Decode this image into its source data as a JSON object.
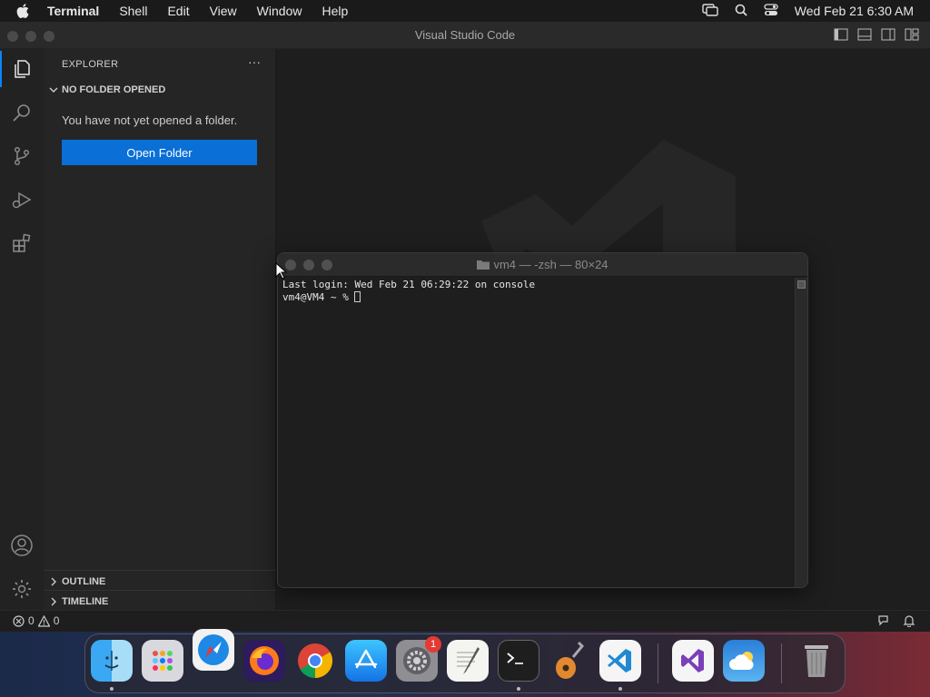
{
  "menubar": {
    "app_name": "Terminal",
    "items": [
      "Shell",
      "Edit",
      "View",
      "Window",
      "Help"
    ],
    "datetime": "Wed Feb 21  6:30 AM"
  },
  "vscode": {
    "window_title": "Visual Studio Code",
    "sidebar": {
      "title": "EXPLORER",
      "more": "···",
      "section_no_folder": "NO FOLDER OPENED",
      "message": "You have not yet opened a folder.",
      "open_folder_label": "Open Folder",
      "section_outline": "OUTLINE",
      "section_timeline": "TIMELINE"
    },
    "statusbar": {
      "errors": "0",
      "warnings": "0"
    }
  },
  "terminal": {
    "title": "vm4 — -zsh — 80×24",
    "line1": "Last login: Wed Feb 21 06:29:22 on console",
    "prompt": "vm4@VM4 ~ % "
  },
  "dock": {
    "settings_badge": "1"
  },
  "colors": {
    "accent": "#0a6fd6",
    "active_bar": "#0a84ff"
  }
}
